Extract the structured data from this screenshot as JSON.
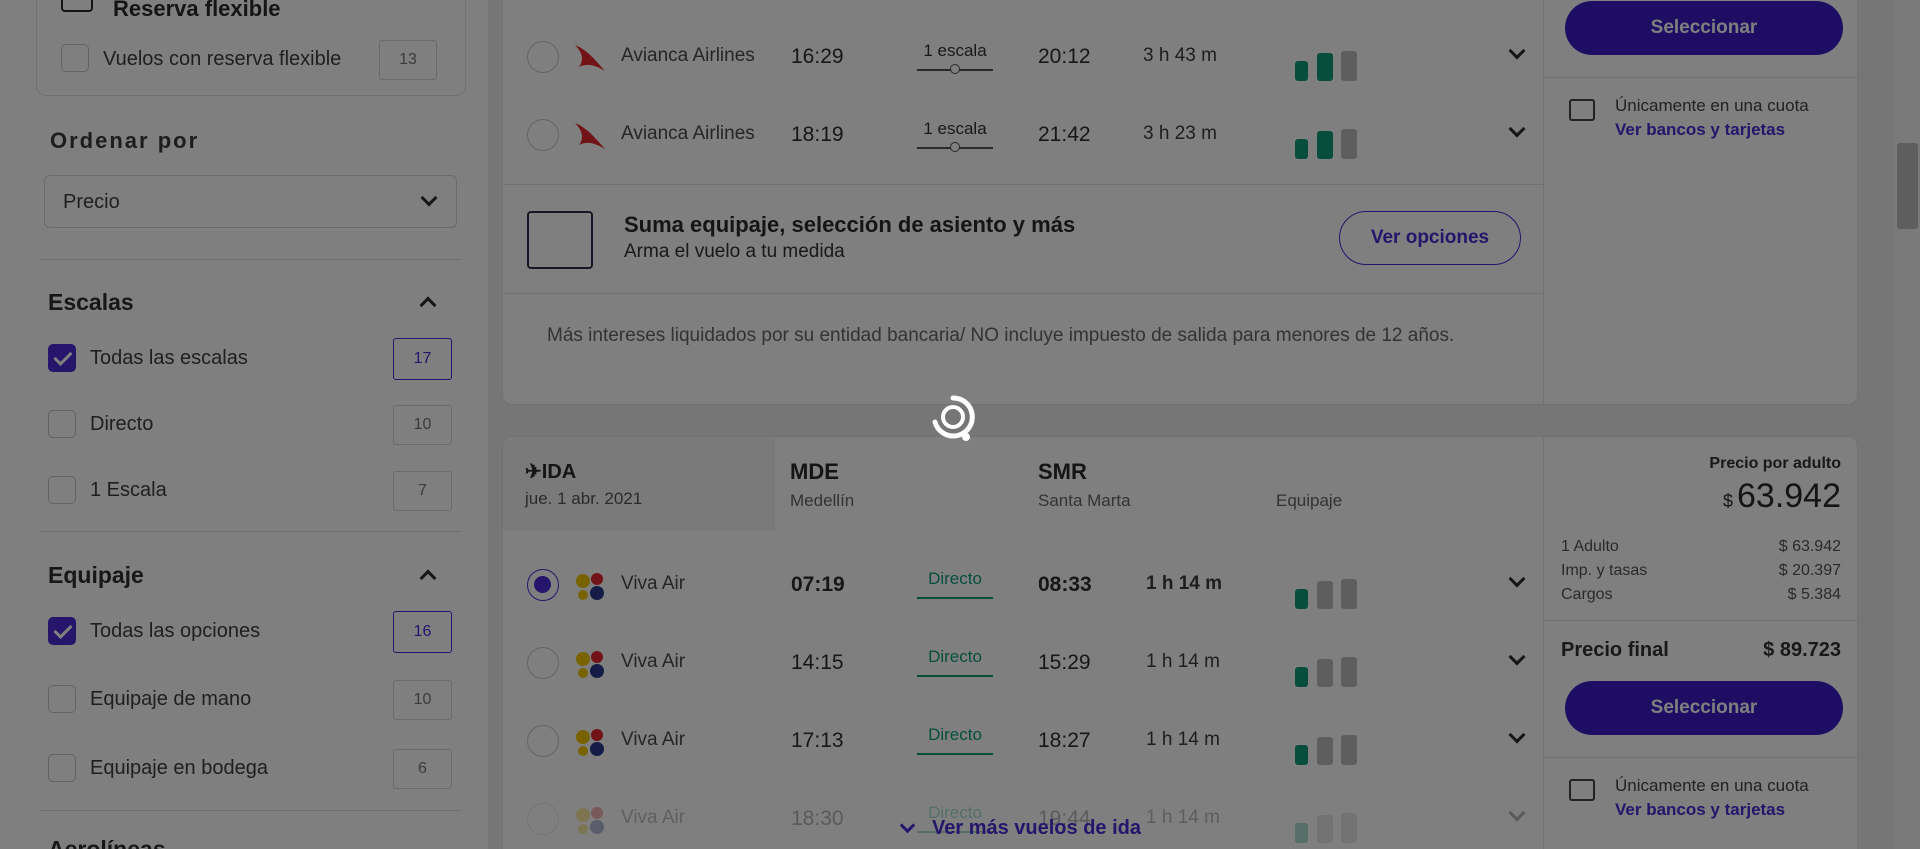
{
  "sidebar": {
    "flexible": {
      "title": "Reserva flexible",
      "option": {
        "label": "Vuelos con reserva flexible",
        "count": "13",
        "checked": false
      }
    },
    "order": {
      "title": "Ordenar por",
      "selected": "Precio"
    },
    "stops": {
      "title": "Escalas",
      "options": [
        {
          "label": "Todas las escalas",
          "count": "17",
          "checked": true
        },
        {
          "label": "Directo",
          "count": "10",
          "checked": false
        },
        {
          "label": "1 Escala",
          "count": "7",
          "checked": false
        }
      ]
    },
    "luggage": {
      "title": "Equipaje",
      "options": [
        {
          "label": "Todas las opciones",
          "count": "16",
          "checked": true
        },
        {
          "label": "Equipaje de mano",
          "count": "10",
          "checked": false
        },
        {
          "label": "Equipaje en bodega",
          "count": "6",
          "checked": false
        }
      ]
    },
    "next_section_partial": "Aerolíneas"
  },
  "card1": {
    "flights": [
      {
        "airline": "Avianca Airlines",
        "depart": "16:29",
        "stops": "1 escala",
        "arrive": "20:12",
        "duration": "3 h 43 m"
      },
      {
        "airline": "Avianca Airlines",
        "depart": "18:19",
        "stops": "1 escala",
        "arrive": "21:42",
        "duration": "3 h 23 m"
      }
    ],
    "promo": {
      "title": "Suma equipaje, selección de asiento y más",
      "subtitle": "Arma el vuelo a tu medida",
      "button": "Ver opciones"
    },
    "note": "Más intereses liquidados por su entidad bancaria/ NO incluye impuesto de salida para menores de 12 años.",
    "select_button": "Seleccionar",
    "cuota": "Únicamente en una cuota",
    "bank_link": "Ver bancos y tarjetas"
  },
  "card2": {
    "direction": "✈IDA",
    "date": "jue. 1 abr. 2021",
    "origin": {
      "code": "MDE",
      "city": "Medellín"
    },
    "destination": {
      "code": "SMR",
      "city": "Santa Marta"
    },
    "luggage_header": "Equipaje",
    "flights": [
      {
        "airline": "Viva Air",
        "depart": "07:19",
        "stops": "Directo",
        "arrive": "08:33",
        "duration": "1 h 14 m",
        "selected": true
      },
      {
        "airline": "Viva Air",
        "depart": "14:15",
        "stops": "Directo",
        "arrive": "15:29",
        "duration": "1 h 14 m",
        "selected": false
      },
      {
        "airline": "Viva Air",
        "depart": "17:13",
        "stops": "Directo",
        "arrive": "18:27",
        "duration": "1 h 14 m",
        "selected": false
      },
      {
        "airline": "Viva Air",
        "depart": "18:30",
        "stops": "Directo",
        "arrive": "19:44",
        "duration": "1 h 14 m",
        "selected": false
      }
    ],
    "price": {
      "label": "Precio por adulto",
      "currency": "$",
      "amount": "63.942",
      "breakdown": [
        {
          "label": "1 Adulto",
          "value": "$ 63.942"
        },
        {
          "label": "Imp. y tasas",
          "value": "$ 20.397"
        },
        {
          "label": "Cargos",
          "value": "$ 5.384"
        }
      ],
      "final_label": "Precio final",
      "final_value": "$ 89.723"
    },
    "select_button": "Seleccionar",
    "cuota": "Únicamente en una cuota",
    "bank_link": "Ver bancos y tarjetas",
    "more_flights": "Ver más vuelos de ida"
  },
  "colors": {
    "primary": "#4b2bd6",
    "primary_button": "#3b1dc9",
    "direct_green": "#0f9d79",
    "avianca_red": "#e3262e",
    "overlay": "rgba(0,0,0,0.5)"
  },
  "loading": true
}
